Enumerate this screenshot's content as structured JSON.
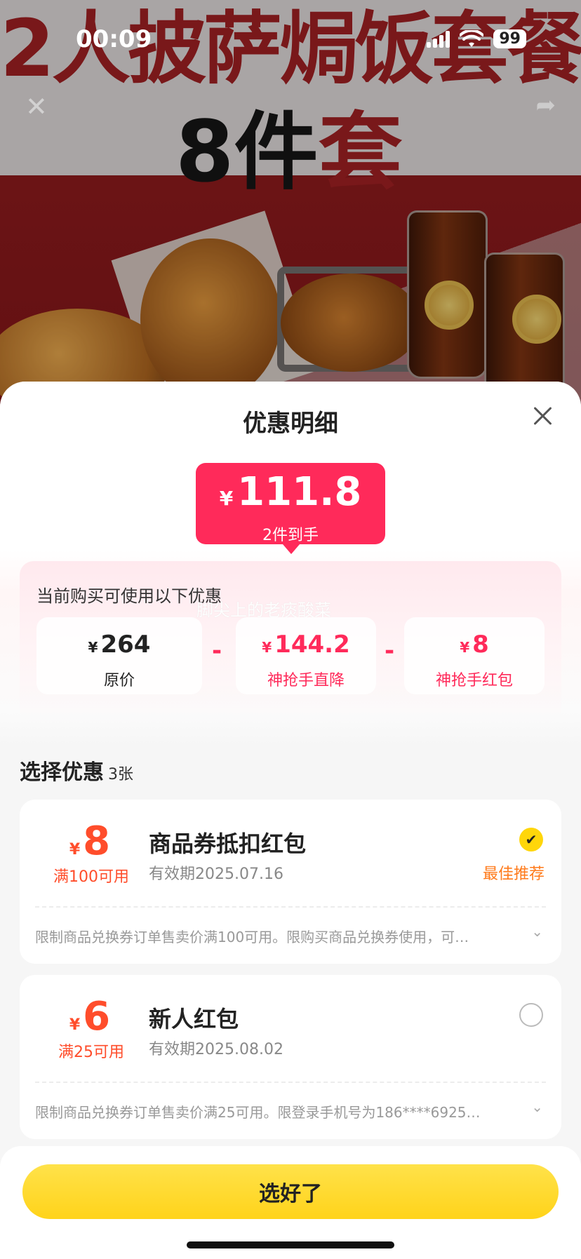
{
  "status_bar": {
    "time": "00:09",
    "battery": "99"
  },
  "background": {
    "title_line1": "2人披萨焗饭套餐",
    "title_line2_a": "8件",
    "title_line2_b": "套"
  },
  "sheet": {
    "title": "优惠明细",
    "price": {
      "currency": "¥",
      "amount": "111.8",
      "subtitle": "2件到手"
    },
    "discounts": {
      "caption": "当前购买可使用以下优惠",
      "watermark": "脚尖上的老痰酸菜",
      "items": [
        {
          "currency": "¥",
          "amount": "264",
          "label": "原价"
        },
        {
          "currency": "¥",
          "amount": "144.2",
          "label": "神抢手直降"
        },
        {
          "currency": "¥",
          "amount": "8",
          "label": "神抢手红包"
        }
      ],
      "operator": "-"
    },
    "select": {
      "title": "选择优惠",
      "count": "3张"
    },
    "coupons": [
      {
        "currency": "¥",
        "amount": "8",
        "condition": "满100可用",
        "name": "商品券抵扣红包",
        "expiry": "有效期2025.07.16",
        "selected": true,
        "tag": "最佳推荐",
        "description": "限制商品兑换券订单售卖价满100可用。限购买商品兑换券使用，可…"
      },
      {
        "currency": "¥",
        "amount": "6",
        "condition": "满25可用",
        "name": "新人红包",
        "expiry": "有效期2025.08.02",
        "selected": false,
        "tag": "",
        "description": "限制商品兑换券订单售卖价满25可用。限登录手机号为186****6925…"
      }
    ],
    "confirm_label": "选好了"
  },
  "colors": {
    "accent": "#ff2a5a",
    "coupon": "#ff4d2b",
    "button": "#ffd31a",
    "best_tag": "#ff7a1a"
  }
}
